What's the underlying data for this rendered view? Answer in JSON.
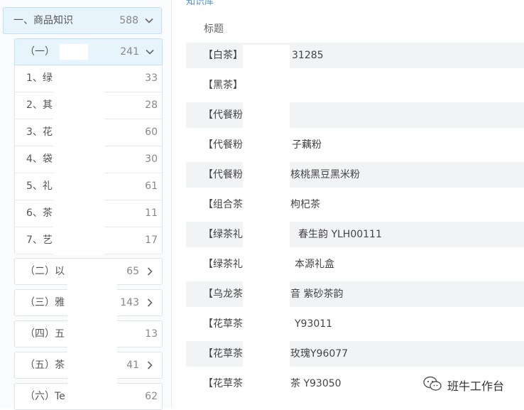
{
  "sidebar": {
    "root": {
      "label": "一、商品知识",
      "count": "588"
    },
    "sub1": {
      "label": "（一）",
      "count": "241"
    },
    "leaves": [
      {
        "label": "1、绿",
        "count": "33"
      },
      {
        "label": "2、其",
        "count": "28"
      },
      {
        "label": "3、花",
        "count": "60"
      },
      {
        "label": "4、袋",
        "count": "30"
      },
      {
        "label": "5、礼",
        "count": "61"
      },
      {
        "label": "6、茶",
        "count": "11"
      },
      {
        "label": "7、艺",
        "count": "17"
      }
    ],
    "subs": [
      {
        "label": "（二）以",
        "count": "65"
      },
      {
        "label": "（三）雅",
        "count": "143"
      },
      {
        "label": "（四）五",
        "count": "13"
      },
      {
        "label": "（五）茶",
        "count": "41"
      },
      {
        "label": "（六）Te",
        "count": "62"
      }
    ]
  },
  "main": {
    "section_title": "知识库",
    "column_header": "标题",
    "rows": [
      {
        "title": "【白茶】",
        "tail": "31285"
      },
      {
        "title": "【黑茶】",
        "tail": ""
      },
      {
        "title": "【代餐粉",
        "tail": ""
      },
      {
        "title": "【代餐粉",
        "tail": "子藕粉"
      },
      {
        "title": "【代餐粉",
        "tail": "核桃黑豆黑米粉"
      },
      {
        "title": "【组合茶",
        "tail": "枸杞茶"
      },
      {
        "title": "【绿茶礼",
        "tail": "春生韵 YLH00111"
      },
      {
        "title": "【绿茶礼",
        "tail": "本源礼盒"
      },
      {
        "title": "【乌龙茶",
        "tail": "音 紫砂茶韵"
      },
      {
        "title": "【花草茶",
        "tail": "Y93011"
      },
      {
        "title": "【花草茶",
        "tail": "玫瑰Y96077"
      },
      {
        "title": "【花草茶",
        "tail": "茶 Y93050"
      }
    ]
  },
  "watermark": {
    "text": "班牛工作台",
    "icon": "wechat-icon"
  }
}
